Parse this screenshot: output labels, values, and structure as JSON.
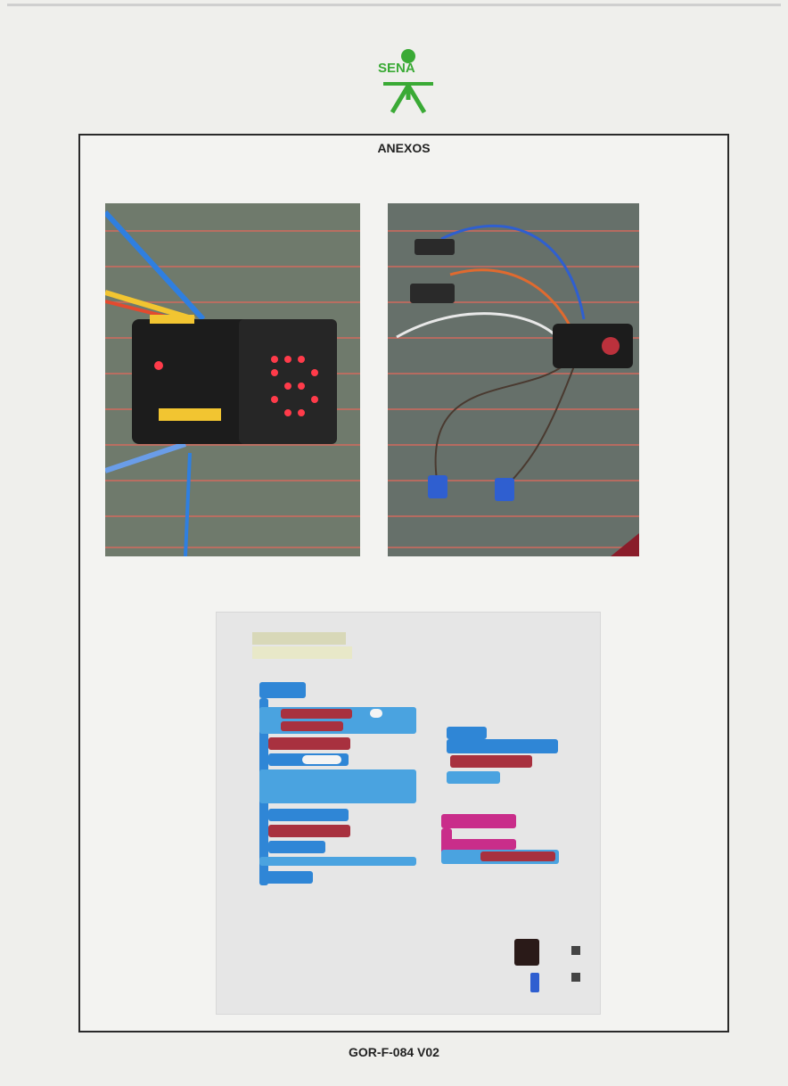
{
  "header": {
    "logo_text": "SENA"
  },
  "document": {
    "heading": "ANEXOS"
  },
  "footer": {
    "form_code": "GOR-F-084 V02"
  },
  "colors": {
    "frame": "#2a2a2a",
    "sena_green": "#3aaa35",
    "led_red": "#ff3b4a",
    "block_blue": "#2f86d6",
    "block_red": "#a8313f",
    "block_pink": "#c92d8a"
  },
  "figures": [
    {
      "name": "photo-microbit-board",
      "icon": "microbit-board-photo"
    },
    {
      "name": "photo-circuit-servos",
      "icon": "servo-circuit-photo"
    },
    {
      "name": "code-blocks-screenshot",
      "icon": "makecode-blocks-image"
    }
  ]
}
